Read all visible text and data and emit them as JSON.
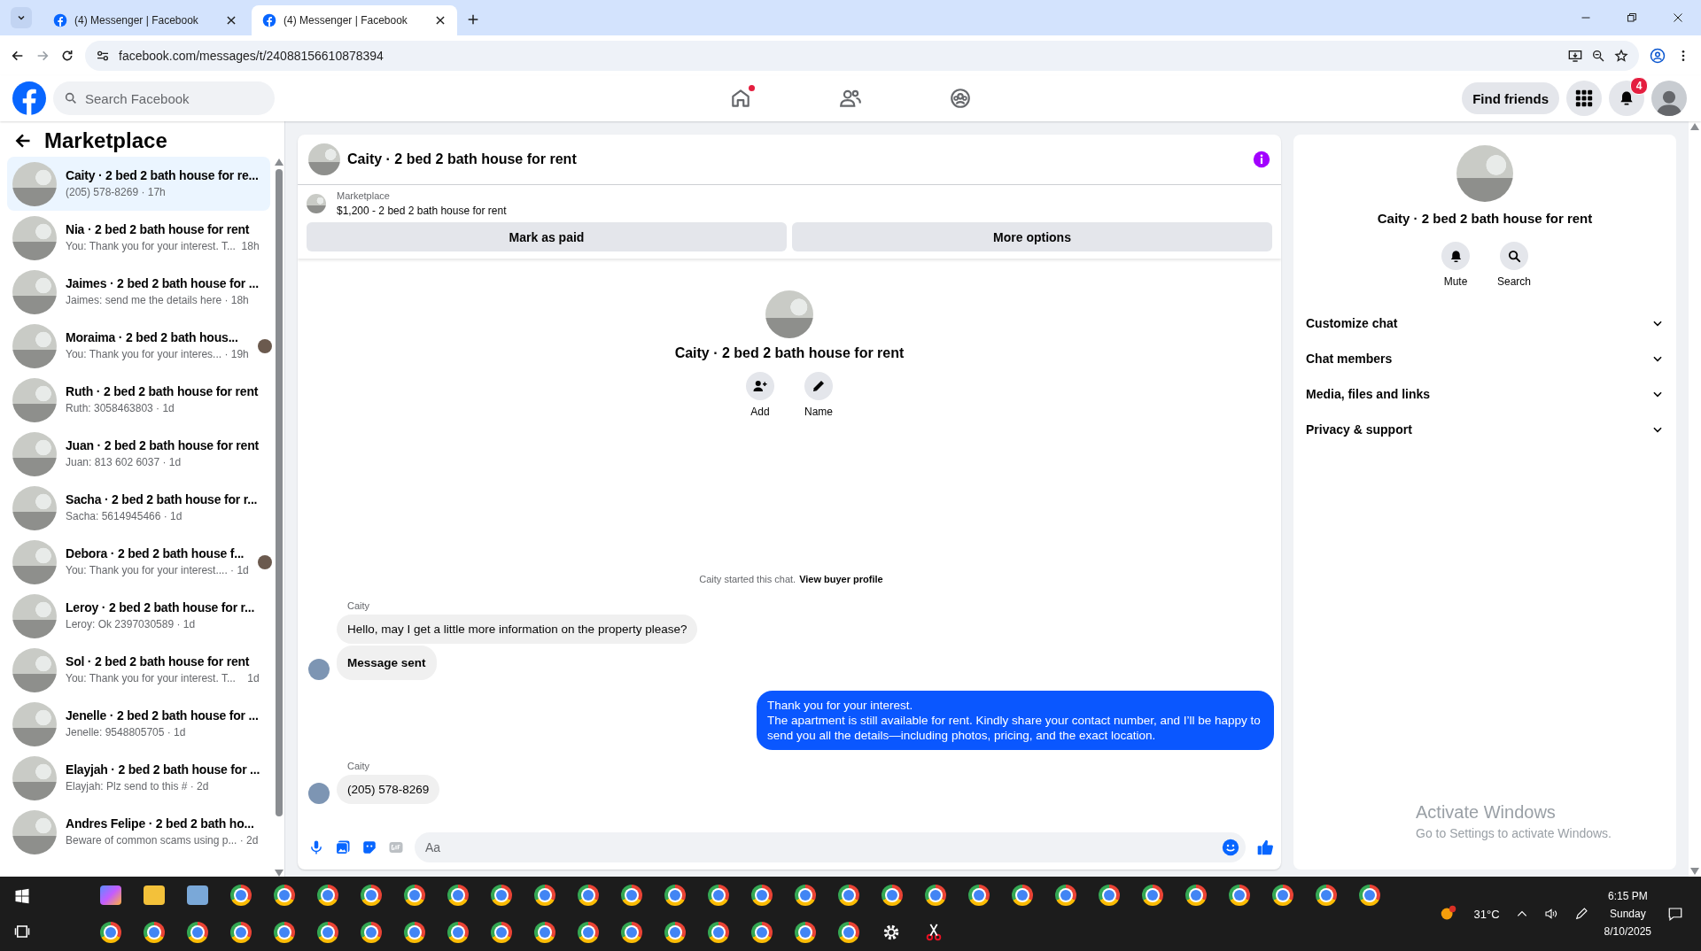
{
  "browser": {
    "tabs": [
      {
        "title": "(4) Messenger | Facebook",
        "selected": false
      },
      {
        "title": "(4) Messenger | Facebook",
        "selected": true
      }
    ],
    "url": "facebook.com/messages/t/24088156610878394"
  },
  "header": {
    "search": {
      "placeholder": "Search Facebook"
    },
    "nav": [
      {
        "kind": "home",
        "dot": true
      },
      {
        "kind": "friends",
        "dot": false
      },
      {
        "kind": "groups",
        "dot": false
      }
    ],
    "find_friends": "Find friends",
    "notification_count": "4"
  },
  "sidebar": {
    "title": "Marketplace",
    "conversations": [
      {
        "title": "Caity · 2 bed 2 bath house for re...",
        "subtitle": "(205) 578-8269 · 17h",
        "selected": true,
        "seen": false
      },
      {
        "title": "Nia · 2 bed 2 bath house for rent",
        "subtitle": "You: Thank you for your interest. T...  18h",
        "selected": false,
        "seen": false
      },
      {
        "title": "Jaimes · 2 bed 2 bath house for ...",
        "subtitle": "Jaimes: send me the details here · 18h",
        "selected": false,
        "seen": false
      },
      {
        "title": "Moraima · 2 bed 2 bath hous...",
        "subtitle": "You: Thank you for your interes... · 19h",
        "selected": false,
        "seen": true
      },
      {
        "title": "Ruth · 2 bed 2 bath house for rent",
        "subtitle": "Ruth: 3058463803 · 1d",
        "selected": false,
        "seen": false
      },
      {
        "title": "Juan · 2 bed 2 bath house for rent",
        "subtitle": "Juan: 813 602 6037 · 1d",
        "selected": false,
        "seen": false
      },
      {
        "title": "Sacha · 2 bed 2 bath house for r...",
        "subtitle": "Sacha: 5614945466 · 1d",
        "selected": false,
        "seen": false
      },
      {
        "title": "Debora · 2 bed 2 bath house f...",
        "subtitle": "You: Thank you for your interest.... · 1d",
        "selected": false,
        "seen": true
      },
      {
        "title": "Leroy · 2 bed 2 bath house for r...",
        "subtitle": "Leroy: Ok 2397030589 · 1d",
        "selected": false,
        "seen": false
      },
      {
        "title": "Sol · 2 bed 2 bath house for rent",
        "subtitle": "You: Thank you for your interest. T...    1d",
        "selected": false,
        "seen": false
      },
      {
        "title": "Jenelle · 2 bed 2 bath house for ...",
        "subtitle": "Jenelle: 9548805705 · 1d",
        "selected": false,
        "seen": false
      },
      {
        "title": "Elayjah · 2 bed 2 bath house for ...",
        "subtitle": "Elayjah: Plz send to this # · 2d",
        "selected": false,
        "seen": false
      },
      {
        "title": "Andres Felipe · 2 bed 2 bath ho...",
        "subtitle": "Beware of common scams using p... · 2d",
        "selected": false,
        "seen": false
      }
    ]
  },
  "chat": {
    "title": "Caity · 2 bed 2 bath house for rent",
    "listing": {
      "label": "Marketplace",
      "text": "$1,200 - 2 bed 2 bath house for rent"
    },
    "buttons": [
      "Mark as paid",
      "More options"
    ],
    "profile": {
      "name": "Caity · 2 bed 2 bath house for rent",
      "actions": [
        {
          "label": "Add",
          "kind": "add"
        },
        {
          "label": "Name",
          "kind": "edit"
        }
      ]
    },
    "note": "Caity started this chat.",
    "note_link": "View buyer profile",
    "groups": [
      {
        "sender": "Caity",
        "outgoing": false,
        "messages": [
          {
            "text": "Hello, may I get a little more information on the property please?",
            "kind": "text"
          },
          {
            "text": "Message sent",
            "kind": "status"
          }
        ]
      },
      {
        "outgoing": true,
        "messages": [
          {
            "text": "Thank you for your interest.\nThe apartment is still available for rent. Kindly share your contact number, and I’ll be happy to send you all the details—including photos, pricing, and the exact location.",
            "kind": "text"
          }
        ]
      },
      {
        "sender": "Caity",
        "outgoing": false,
        "messages": [
          {
            "text": "(205) 578-8269",
            "kind": "text"
          }
        ]
      }
    ],
    "composer": {
      "placeholder": "Aa"
    }
  },
  "details": {
    "name": "Caity · 2 bed 2 bath house for rent",
    "actions": [
      {
        "label": "Mute",
        "kind": "bell"
      },
      {
        "label": "Search",
        "kind": "search"
      }
    ],
    "sections": [
      {
        "label": "Customize chat",
        "expanded": false
      },
      {
        "label": "Chat members",
        "expanded": false
      },
      {
        "label": "Media, files and links",
        "expanded": false
      },
      {
        "label": "Privacy & support",
        "expanded": false
      }
    ]
  },
  "activation_notice": {
    "title": "Activate Windows",
    "text": "Go to Settings to activate Windows."
  },
  "taskbar": {
    "weather": "31°C",
    "time": "6:15 PM",
    "day": "Sunday",
    "date": "8/10/2025"
  }
}
